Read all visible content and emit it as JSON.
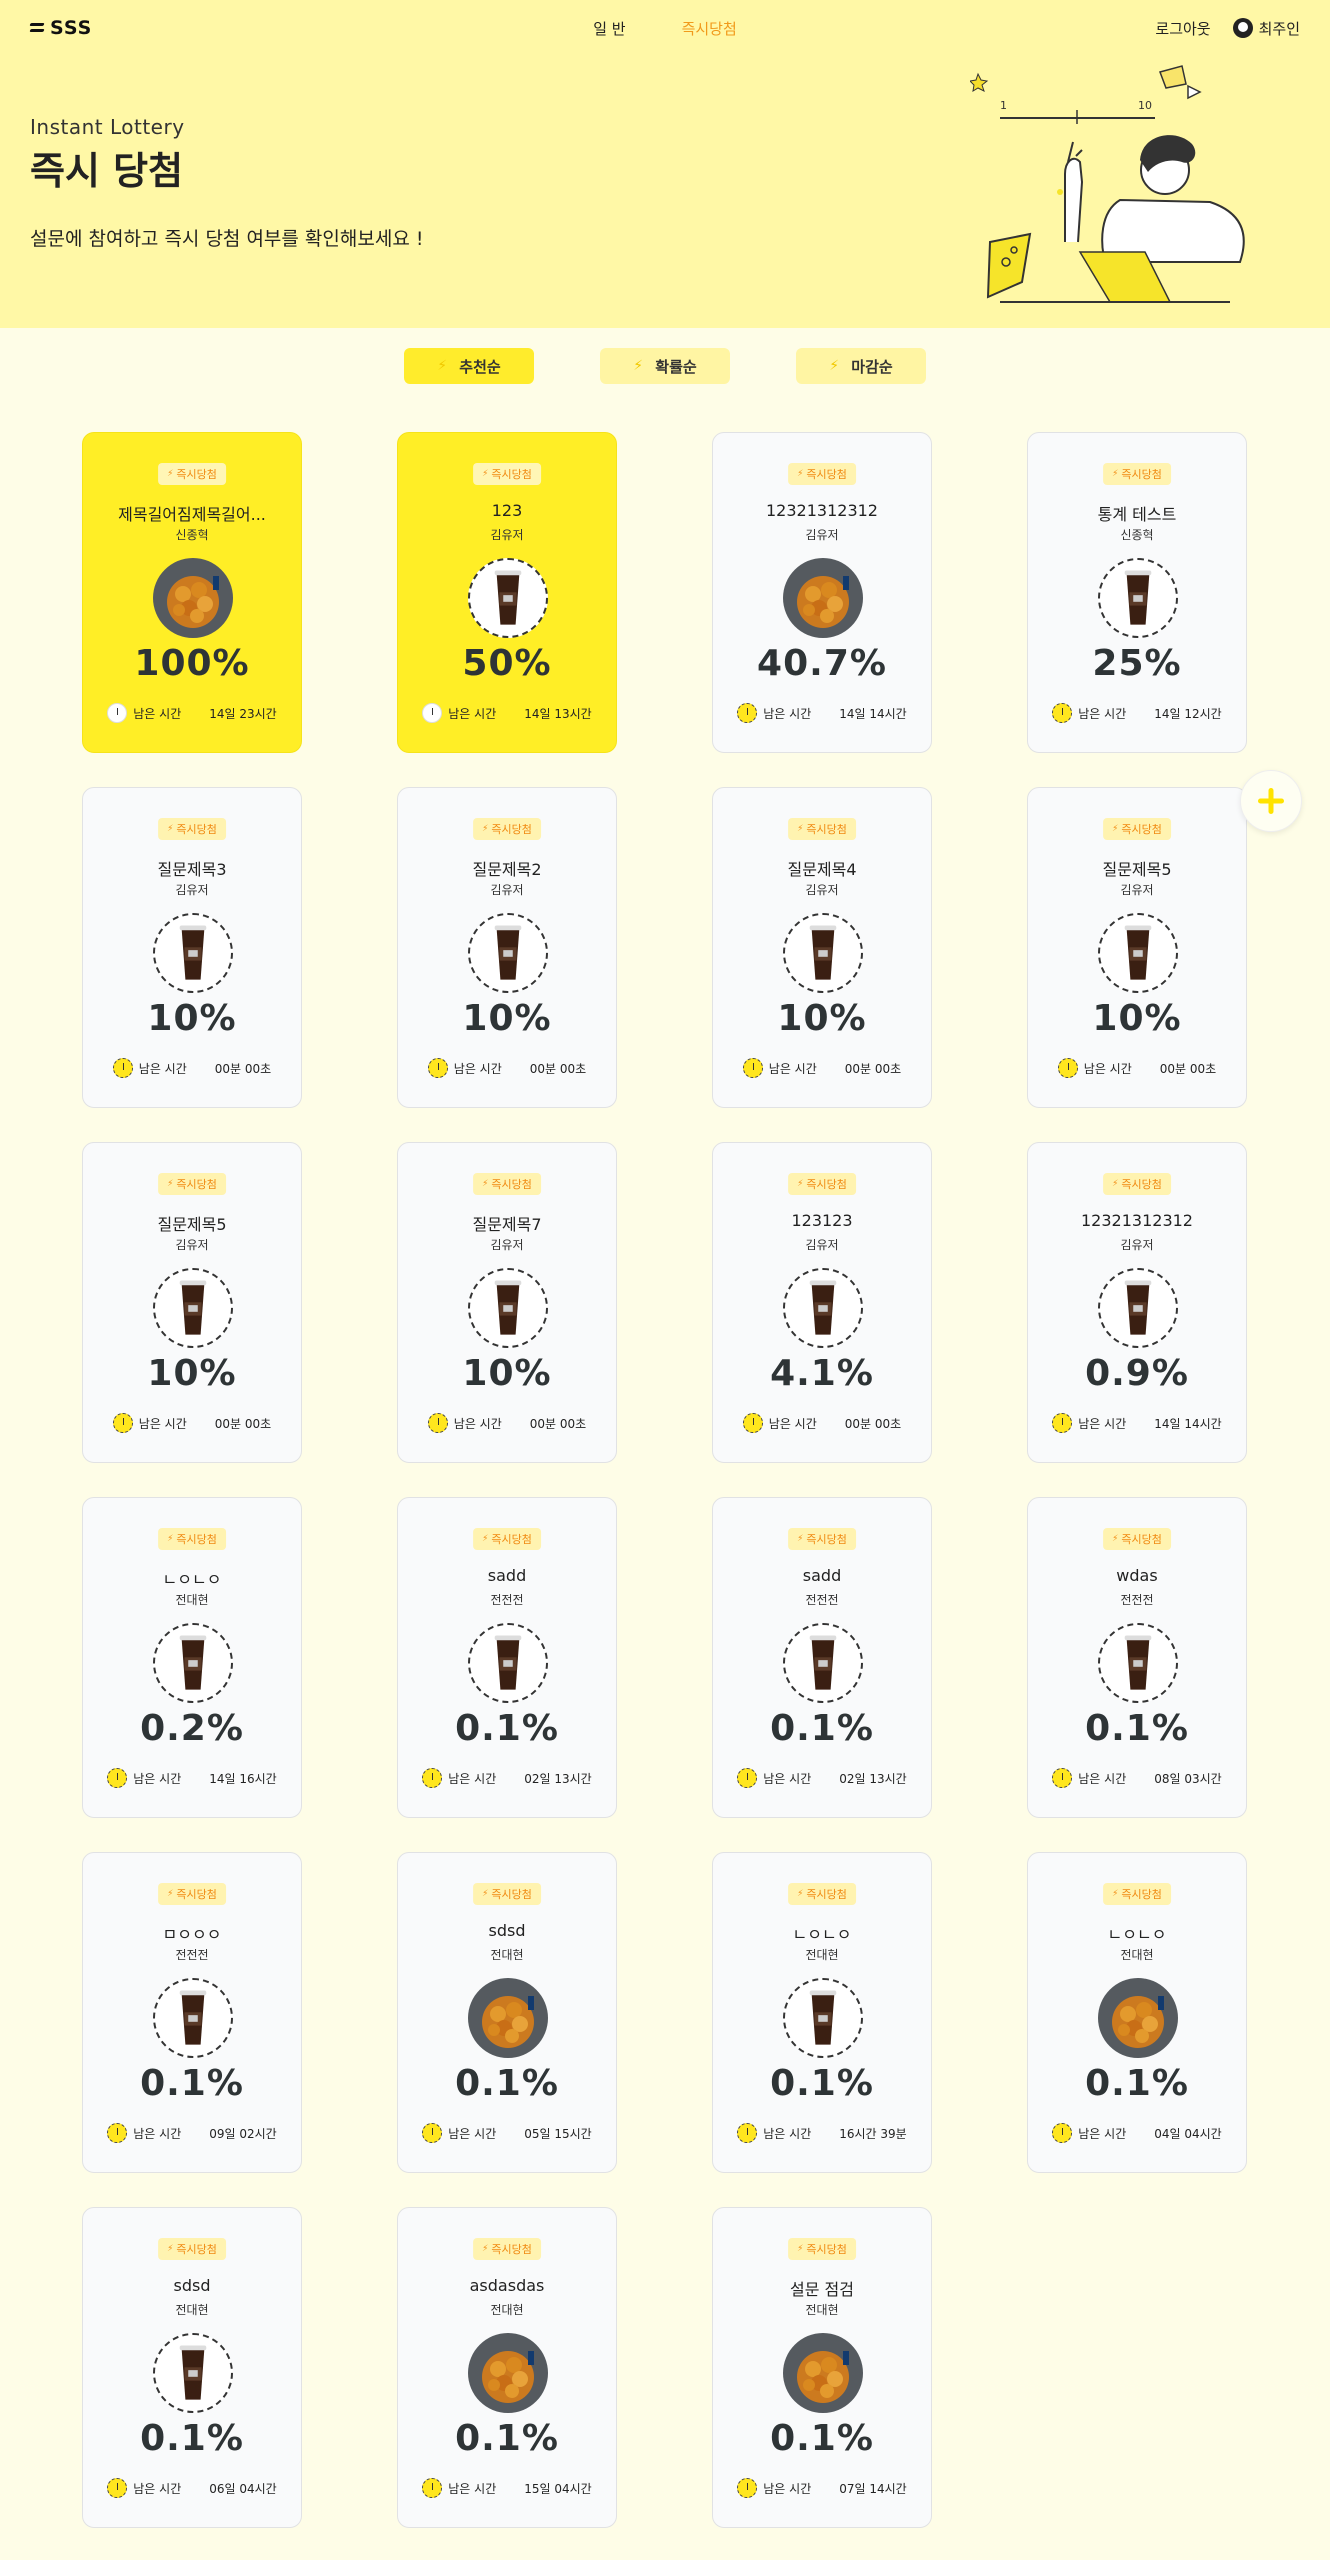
{
  "header": {
    "logo": "SSS",
    "nav": [
      "일 반",
      "즉시당첨"
    ],
    "logout": "로그아웃",
    "username": "최주인"
  },
  "hero": {
    "subtitle": "Instant Lottery",
    "title": "즉시 당첨",
    "description": "설문에 참여하고 즉시 당첨 여부를 확인해보세요 !",
    "slider_min": "1",
    "slider_max": "10"
  },
  "sort": [
    "추천순",
    "확률순",
    "마감순"
  ],
  "colors": {
    "accent": "#ffee26",
    "nav_active": "#f19a1b",
    "badge_text": "#f08a12"
  },
  "cards": [
    {
      "badge": "즉시당첨",
      "title": "제목길어짐제목길어...",
      "author": "신종혁",
      "image": "chicken-image",
      "rate": "100%",
      "remain_label": "남은 시간",
      "time": "14일 23시간",
      "hot": true
    },
    {
      "badge": "즉시당첨",
      "title": "123",
      "author": "김유저",
      "image": "coffee-image",
      "rate": "50%",
      "remain_label": "남은 시간",
      "time": "14일 13시간",
      "hot": true
    },
    {
      "badge": "즉시당첨",
      "title": "12321312312",
      "author": "김유저",
      "image": "chicken-image",
      "rate": "40.7%",
      "remain_label": "남은 시간",
      "time": "14일 14시간",
      "hot": false
    },
    {
      "badge": "즉시당첨",
      "title": "통계 테스트",
      "author": "신종혁",
      "image": "coffee-image",
      "rate": "25%",
      "remain_label": "남은 시간",
      "time": "14일 12시간",
      "hot": false
    },
    {
      "badge": "즉시당첨",
      "title": "질문제목3",
      "author": "김유저",
      "image": "coffee-image",
      "rate": "10%",
      "remain_label": "남은 시간",
      "time": "00분 00초",
      "hot": false
    },
    {
      "badge": "즉시당첨",
      "title": "질문제목2",
      "author": "김유저",
      "image": "coffee-image",
      "rate": "10%",
      "remain_label": "남은 시간",
      "time": "00분 00초",
      "hot": false
    },
    {
      "badge": "즉시당첨",
      "title": "질문제목4",
      "author": "김유저",
      "image": "coffee-image",
      "rate": "10%",
      "remain_label": "남은 시간",
      "time": "00분 00초",
      "hot": false
    },
    {
      "badge": "즉시당첨",
      "title": "질문제목5",
      "author": "김유저",
      "image": "coffee-image",
      "rate": "10%",
      "remain_label": "남은 시간",
      "time": "00분 00초",
      "hot": false
    },
    {
      "badge": "즉시당첨",
      "title": "질문제목5",
      "author": "김유저",
      "image": "coffee-image",
      "rate": "10%",
      "remain_label": "남은 시간",
      "time": "00분 00초",
      "hot": false
    },
    {
      "badge": "즉시당첨",
      "title": "질문제목7",
      "author": "김유저",
      "image": "coffee-image",
      "rate": "10%",
      "remain_label": "남은 시간",
      "time": "00분 00초",
      "hot": false
    },
    {
      "badge": "즉시당첨",
      "title": "123123",
      "author": "김유저",
      "image": "coffee-image",
      "rate": "4.1%",
      "remain_label": "남은 시간",
      "time": "00분 00초",
      "hot": false
    },
    {
      "badge": "즉시당첨",
      "title": "12321312312",
      "author": "김유저",
      "image": "coffee-image",
      "rate": "0.9%",
      "remain_label": "남은 시간",
      "time": "14일 14시간",
      "hot": false
    },
    {
      "badge": "즉시당첨",
      "title": "ㄴㅇㄴㅇ",
      "author": "전대현",
      "image": "coffee-image",
      "rate": "0.2%",
      "remain_label": "남은 시간",
      "time": "14일 16시간",
      "hot": false
    },
    {
      "badge": "즉시당첨",
      "title": "sadd",
      "author": "전전전",
      "image": "coffee-image",
      "rate": "0.1%",
      "remain_label": "남은 시간",
      "time": "02일 13시간",
      "hot": false
    },
    {
      "badge": "즉시당첨",
      "title": "sadd",
      "author": "전전전",
      "image": "coffee-image",
      "rate": "0.1%",
      "remain_label": "남은 시간",
      "time": "02일 13시간",
      "hot": false
    },
    {
      "badge": "즉시당첨",
      "title": "wdas",
      "author": "전전전",
      "image": "coffee-image",
      "rate": "0.1%",
      "remain_label": "남은 시간",
      "time": "08일 03시간",
      "hot": false
    },
    {
      "badge": "즉시당첨",
      "title": "ㅁㅇㅇㅇ",
      "author": "전전전",
      "image": "coffee-image",
      "rate": "0.1%",
      "remain_label": "남은 시간",
      "time": "09일 02시간",
      "hot": false
    },
    {
      "badge": "즉시당첨",
      "title": "sdsd",
      "author": "전대현",
      "image": "chicken-image",
      "rate": "0.1%",
      "remain_label": "남은 시간",
      "time": "05일 15시간",
      "hot": false
    },
    {
      "badge": "즉시당첨",
      "title": "ㄴㅇㄴㅇ",
      "author": "전대현",
      "image": "coffee-image",
      "rate": "0.1%",
      "remain_label": "남은 시간",
      "time": "16시간 39분",
      "hot": false
    },
    {
      "badge": "즉시당첨",
      "title": "ㄴㅇㄴㅇ",
      "author": "전대현",
      "image": "chicken-image",
      "rate": "0.1%",
      "remain_label": "남은 시간",
      "time": "04일 04시간",
      "hot": false
    },
    {
      "badge": "즉시당첨",
      "title": "sdsd",
      "author": "전대현",
      "image": "coffee-image",
      "rate": "0.1%",
      "remain_label": "남은 시간",
      "time": "06일 04시간",
      "hot": false
    },
    {
      "badge": "즉시당첨",
      "title": "asdasdas",
      "author": "전대현",
      "image": "chicken-image",
      "rate": "0.1%",
      "remain_label": "남은 시간",
      "time": "15일 04시간",
      "hot": false
    },
    {
      "badge": "즉시당첨",
      "title": "설문 점검",
      "author": "전대현",
      "image": "chicken-image",
      "rate": "0.1%",
      "remain_label": "남은 시간",
      "time": "07일 14시간",
      "hot": false
    }
  ]
}
